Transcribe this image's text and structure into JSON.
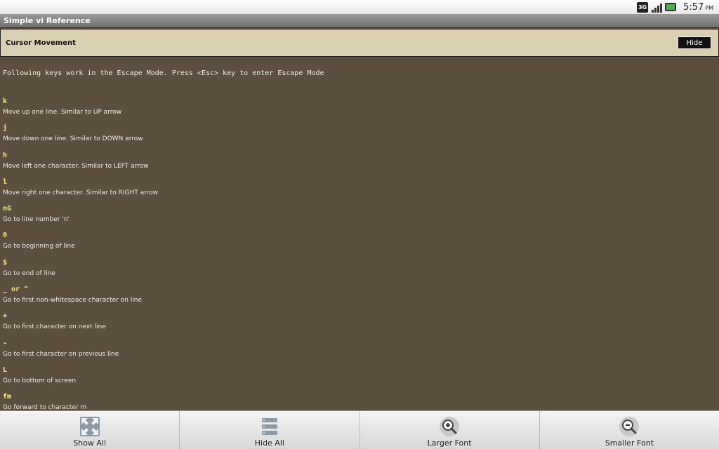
{
  "status": {
    "network": "3G",
    "time": "5:57",
    "ampm": "PM"
  },
  "app": {
    "title": "Simple vi Reference"
  },
  "section": {
    "title": "Cursor Movement",
    "hide_label": "Hide"
  },
  "intro": "Following keys work in the Escape Mode. Press <Esc> key to enter Escape Mode",
  "entries": [
    {
      "key": "k",
      "desc": "Move up one line. Similar to UP arrow"
    },
    {
      "key": "j",
      "desc": "Move down one line. Similar to DOWN arrow"
    },
    {
      "key": "h",
      "desc": "Move left one character. Similar to LEFT arrow"
    },
    {
      "key": "l",
      "desc": "Move right one character. Similar to RIGHT arrow"
    },
    {
      "key": "nG",
      "desc": "Go to line number 'n'"
    },
    {
      "key": "0",
      "desc": "Go to beginning of line"
    },
    {
      "key": "$",
      "desc": "Go to end of line"
    },
    {
      "key": "_ or ^",
      "desc": "Go to first non-whitespace character on line"
    },
    {
      "key": "+",
      "desc": "Go to first character on next line"
    },
    {
      "key": "-",
      "desc": "Go to first character on previous line"
    },
    {
      "key": "L",
      "desc": "Go to bottom of screen"
    },
    {
      "key": "fm",
      "desc": "Go forward to character m"
    }
  ],
  "toolbar": {
    "show_all": "Show All",
    "hide_all": "Hide All",
    "larger_font": "Larger Font",
    "smaller_font": "Smaller Font"
  }
}
